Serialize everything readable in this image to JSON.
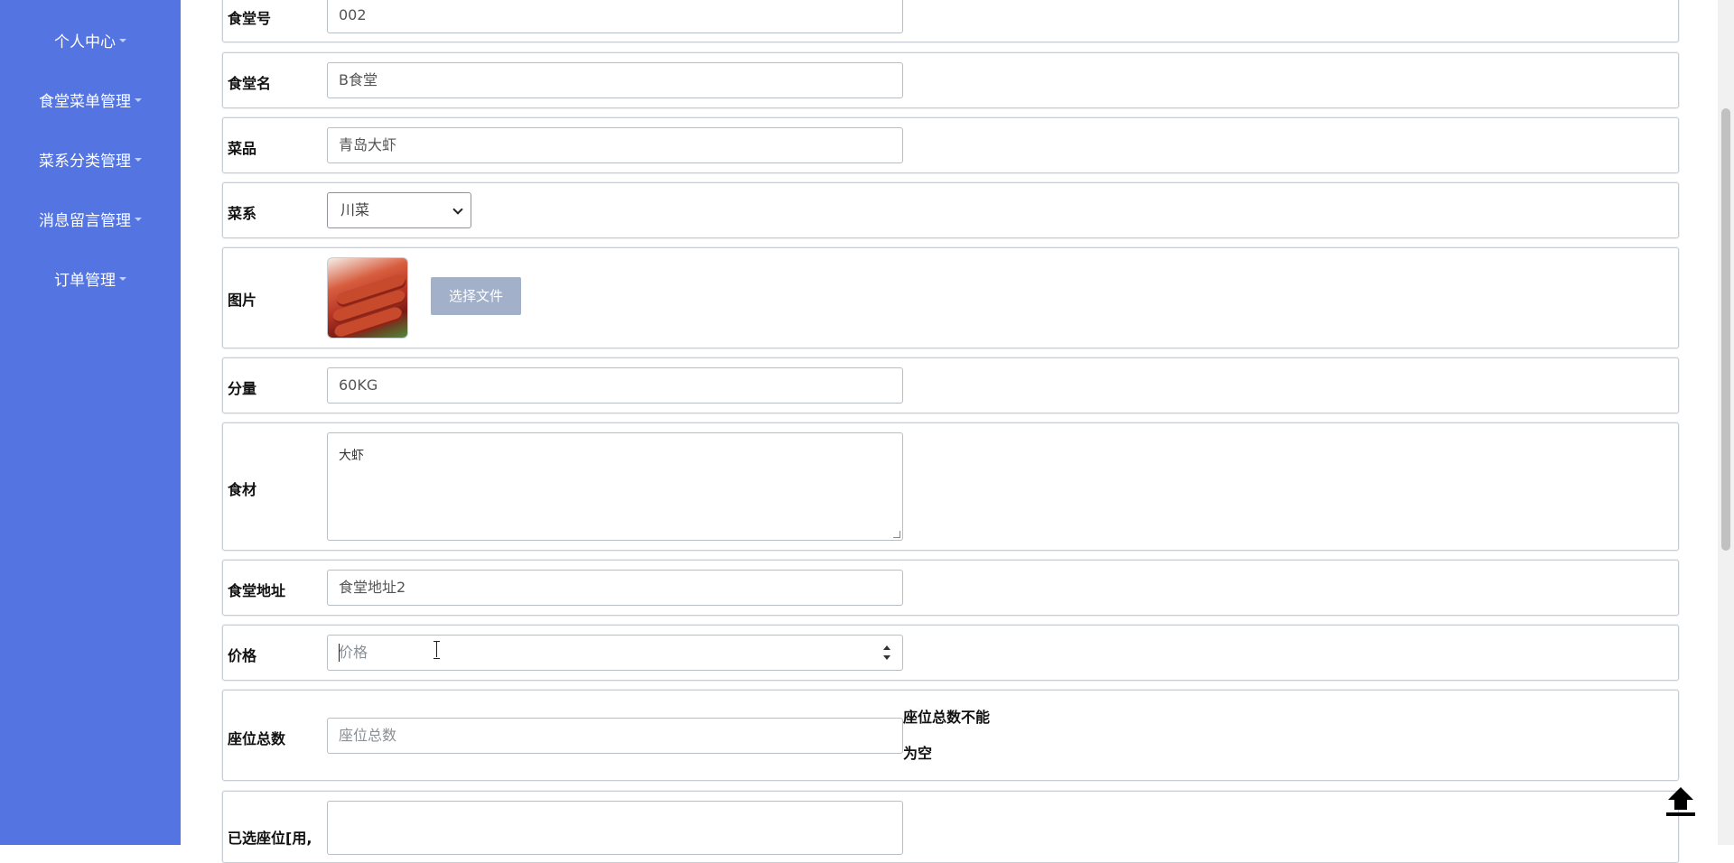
{
  "sidebar": {
    "items": [
      {
        "label": "个人中心"
      },
      {
        "label": "食堂菜单管理"
      },
      {
        "label": "菜系分类管理"
      },
      {
        "label": "消息留言管理"
      },
      {
        "label": "订单管理"
      }
    ]
  },
  "form": {
    "canteen_no": {
      "label": "食堂号",
      "value": "002"
    },
    "canteen_name": {
      "label": "食堂名",
      "value": "B食堂"
    },
    "dish": {
      "label": "菜品",
      "value": "青岛大虾"
    },
    "cuisine": {
      "label": "菜系",
      "selected": "川菜"
    },
    "image": {
      "label": "图片",
      "button": "选择文件"
    },
    "portion": {
      "label": "分量",
      "value": "60KG"
    },
    "ingredients": {
      "label": "食材",
      "value": "大虾"
    },
    "address": {
      "label": "食堂地址",
      "value": "食堂地址2"
    },
    "price": {
      "label": "价格",
      "placeholder": "价格"
    },
    "seats_total": {
      "label": "座位总数",
      "placeholder": "座位总数",
      "error_line1": "座位总数不能",
      "error_line2": "为空"
    },
    "selected_seats": {
      "label": "已选座位[用,"
    }
  },
  "colors": {
    "sidebar_bg": "#5374e1",
    "file_button_bg": "#a2b0c9"
  }
}
